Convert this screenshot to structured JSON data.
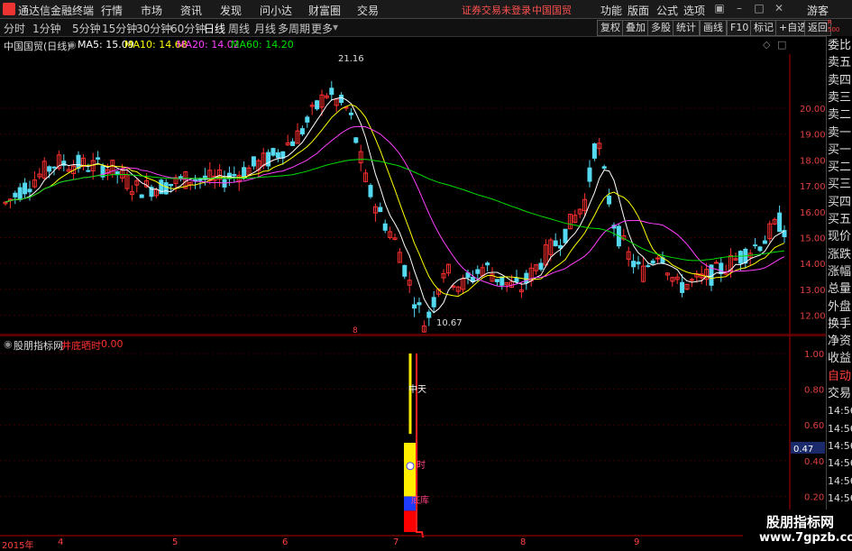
{
  "titlebar": {
    "app_name": "通达信金融终端",
    "menu": [
      "行情",
      "市场",
      "资讯",
      "发现",
      "问小达",
      "财富圈",
      "交易"
    ],
    "warning": "证券交易未登录",
    "stock_name": "中国国贸",
    "right_menu": [
      "功能",
      "版面",
      "公式",
      "选项"
    ],
    "user": "游客"
  },
  "toolbar": {
    "periods": [
      "分时",
      "1分钟",
      "5分钟",
      "15分钟",
      "30分钟",
      "60分钟",
      "日线",
      "周线",
      "月线",
      "多周期",
      "更多"
    ],
    "active_period": "日线",
    "buttons": [
      "复权",
      "叠加",
      "多股",
      "统计",
      "画线",
      "F10",
      "标记",
      "+自选",
      "返回"
    ]
  },
  "main_chart": {
    "title": "中国国贸(日线)",
    "ma": [
      {
        "label": "MA5: 15.09",
        "color": "#ffffff"
      },
      {
        "label": "MA10: 14.68",
        "color": "#ffff00"
      },
      {
        "label": "MA20: 14.02",
        "color": "#ff40ff"
      },
      {
        "label": "MA60: 14.20",
        "color": "#00e000"
      }
    ],
    "y_ticks": [
      "20.00",
      "19.00",
      "18.00",
      "17.00",
      "16.00",
      "15.00",
      "14.00",
      "13.00",
      "12.00"
    ],
    "high_label": "21.16",
    "low_label": "10.67",
    "marker": "8"
  },
  "indicator": {
    "title": "股朋指标网",
    "name": "井底晒时",
    "value": "0.00",
    "y_ticks": [
      "1.00",
      "0.80",
      "0.60",
      "0.47",
      "0.40",
      "0.20"
    ],
    "current": "0.47",
    "labels": [
      "中天",
      "时",
      "底库"
    ]
  },
  "x_axis": [
    "2015年",
    "4",
    "5",
    "6",
    "7",
    "8",
    "9"
  ],
  "sidebar": [
    "委比",
    "卖五",
    "卖四",
    "卖三",
    "卖二",
    "卖一",
    "买一",
    "买二",
    "买三",
    "买四",
    "买五",
    "现价",
    "涨跌",
    "涨幅",
    "总量",
    "外盘",
    "换手",
    "净资",
    "收益",
    "自动",
    "交易",
    "14:56",
    "14:56",
    "14:56",
    "14:56",
    "14:56",
    "14:56",
    "14:56",
    "14:56"
  ],
  "top_right_label": "R\n500",
  "watermark": {
    "line1": "股朋指标网",
    "line2": "www.7gpzb.com"
  }
}
